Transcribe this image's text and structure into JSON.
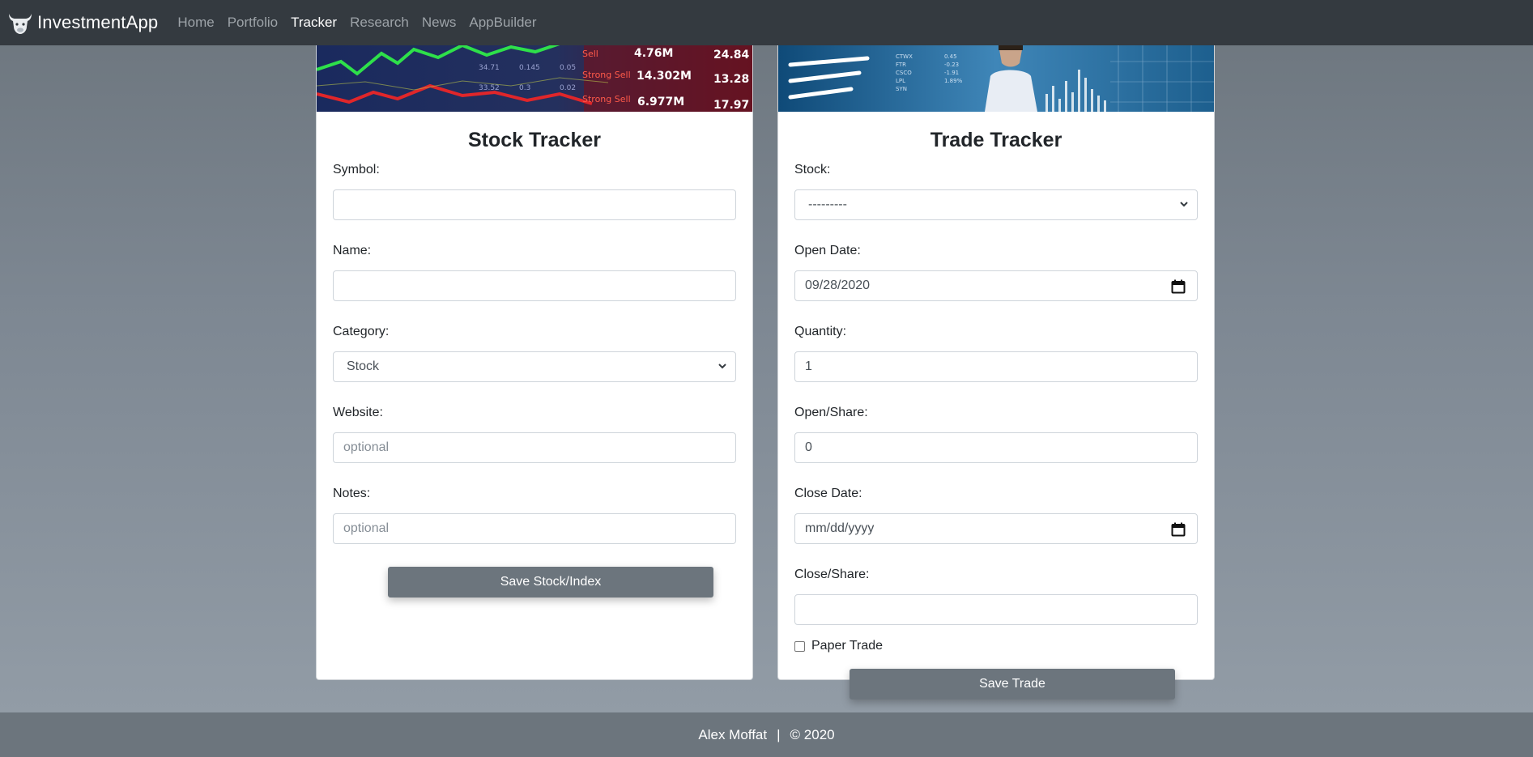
{
  "navbar": {
    "brand": "InvestmentApp",
    "links": [
      {
        "label": "Home",
        "active": false
      },
      {
        "label": "Portfolio",
        "active": false
      },
      {
        "label": "Tracker",
        "active": true
      },
      {
        "label": "Research",
        "active": false
      },
      {
        "label": "News",
        "active": false
      },
      {
        "label": "AppBuilder",
        "active": false
      }
    ]
  },
  "stock_tracker": {
    "title": "Stock Tracker",
    "symbol_label": "Symbol:",
    "symbol_value": "",
    "name_label": "Name:",
    "name_value": "",
    "category_label": "Category:",
    "category_value": "Stock",
    "website_label": "Website:",
    "website_placeholder": "optional",
    "notes_label": "Notes:",
    "notes_placeholder": "optional",
    "save_label": "Save Stock/Index"
  },
  "trade_tracker": {
    "title": "Trade Tracker",
    "stock_label": "Stock:",
    "stock_value": "---------",
    "open_date_label": "Open Date:",
    "open_date_value": "09/28/2020",
    "quantity_label": "Quantity:",
    "quantity_value": "1",
    "open_share_label": "Open/Share:",
    "open_share_value": "0",
    "close_date_label": "Close Date:",
    "close_date_value": "mm/dd/yyyy",
    "close_share_label": "Close/Share:",
    "close_share_value": "",
    "paper_trade_label": "Paper Trade",
    "paper_trade_checked": false,
    "save_label": "Save Trade"
  },
  "footer": {
    "author": "Alex Moffat",
    "separator": "|",
    "copyright": "© 2020"
  },
  "icons": {
    "brand": "bull-icon",
    "select": "chevron-down-icon",
    "date": "calendar-icon"
  },
  "colors": {
    "navbar_bg": "#343a40",
    "button_bg": "#6c757d",
    "footer_bg": "#6c757d",
    "nav_active": "#ffffff",
    "nav_inactive": "#9da3a8"
  }
}
